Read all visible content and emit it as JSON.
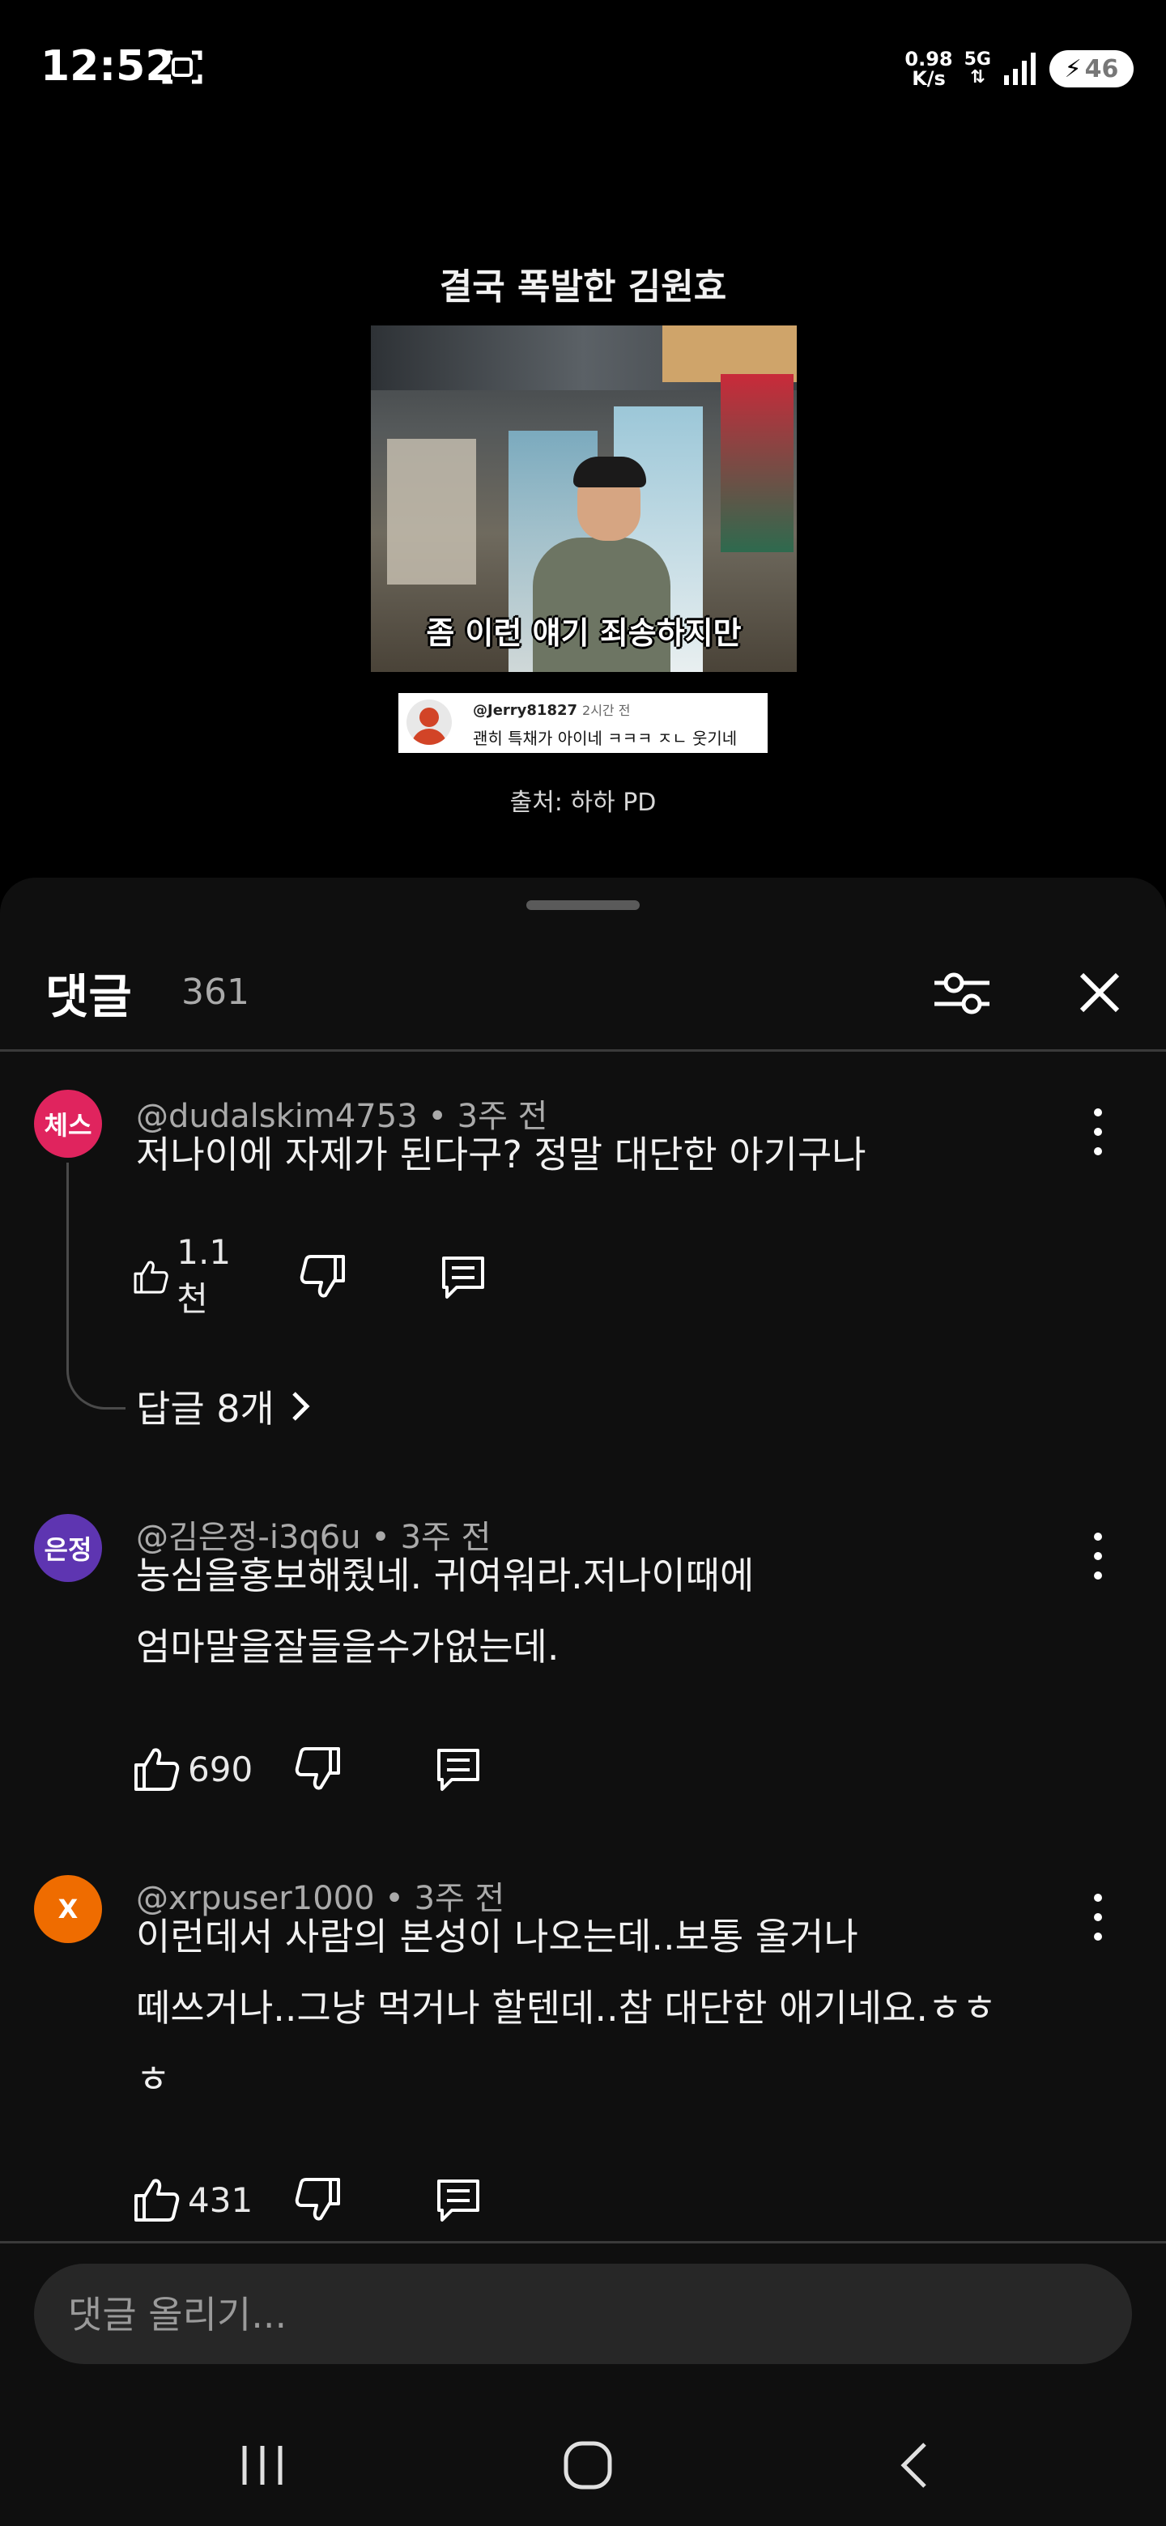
{
  "status_bar": {
    "time": "12:52",
    "net_speed_value": "0.98",
    "net_speed_unit": "K/s",
    "network": "5G",
    "battery": "46"
  },
  "video": {
    "title": "결국 폭발한 김원효",
    "caption": "좀 이런 얘기 죄송하지만",
    "quoted_comment": {
      "user": "@Jerry81827",
      "time": "2시간 전",
      "text": "괜히 특채가 아이네 ㅋㅋㅋ ㅈㄴ 웃기네"
    },
    "source": "출처: 하하 PD"
  },
  "comments_panel": {
    "title": "댓글",
    "count": "361",
    "input_placeholder": "댓글 올리기..."
  },
  "comments": [
    {
      "avatar_text": "체스",
      "avatar_color": "#e0245e",
      "author": "@dudalskim4753",
      "time": "3주 전",
      "lines": [
        "저나이에 자제가 된다구? 정말 대단한 아기구나"
      ],
      "likes": "1.1천",
      "replies": "답글 8개"
    },
    {
      "avatar_text": "은정",
      "avatar_color": "#5e35b1",
      "author": "@김은정-i3q6u",
      "time": "3주 전",
      "lines": [
        "농심을홍보해줬네. 귀여워라.저나이때에",
        "엄마말을잘들을수가없는데."
      ],
      "likes": "690"
    },
    {
      "avatar_text": "X",
      "avatar_color": "#ef6c00",
      "author": "@xrpuser1000",
      "time": "3주 전",
      "lines": [
        "이런데서 사람의 본성이 나오는데..보통 울거나",
        "떼쓰거나..그냥 먹거나 할텐데..참 대단한 애기네요.ㅎㅎ",
        "ㅎ"
      ],
      "likes": "431"
    }
  ],
  "icons": {
    "screenshot": "screenshot-icon",
    "signal": "signal-icon",
    "battery_bolt": "bolt-icon",
    "filter": "sliders-icon",
    "close": "close-icon",
    "like": "thumbs-up-icon",
    "dislike": "thumbs-down-icon",
    "reply": "comment-icon",
    "more": "vertical-dots-icon",
    "chevron": "chevron-right-icon",
    "nav_recents": "recents-icon",
    "nav_home": "home-icon",
    "nav_back": "back-icon"
  }
}
